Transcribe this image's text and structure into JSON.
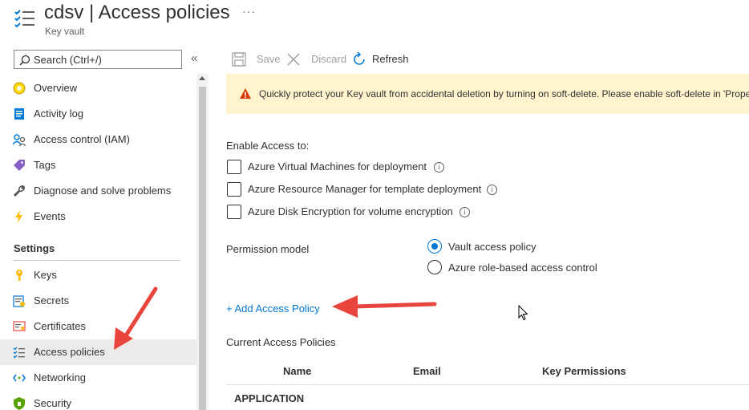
{
  "header": {
    "title": "cdsv | Access policies",
    "subtitle": "Key vault",
    "more": "···"
  },
  "sidebar": {
    "search_placeholder": "Search (Ctrl+/)",
    "collapse": "«",
    "items": [
      {
        "label": "Overview",
        "icon": "overview-icon"
      },
      {
        "label": "Activity log",
        "icon": "activity-log-icon"
      },
      {
        "label": "Access control (IAM)",
        "icon": "iam-icon"
      },
      {
        "label": "Tags",
        "icon": "tag-icon"
      },
      {
        "label": "Diagnose and solve problems",
        "icon": "wrench-icon"
      },
      {
        "label": "Events",
        "icon": "lightning-icon"
      }
    ],
    "settings_header": "Settings",
    "settings_items": [
      {
        "label": "Keys",
        "icon": "key-icon"
      },
      {
        "label": "Secrets",
        "icon": "secrets-icon"
      },
      {
        "label": "Certificates",
        "icon": "certificate-icon"
      },
      {
        "label": "Access policies",
        "icon": "access-policies-icon",
        "active": true
      },
      {
        "label": "Networking",
        "icon": "networking-icon"
      },
      {
        "label": "Security",
        "icon": "shield-icon"
      }
    ]
  },
  "toolbar": {
    "save": "Save",
    "discard": "Discard",
    "refresh": "Refresh"
  },
  "banner": {
    "text": "Quickly protect your Key vault from accidental deletion by turning on soft-delete. Please enable soft-delete in 'Prope"
  },
  "access": {
    "heading": "Enable Access to:",
    "options": [
      {
        "label": "Azure Virtual Machines for deployment",
        "checked": false
      },
      {
        "label": "Azure Resource Manager for template deployment",
        "checked": false
      },
      {
        "label": "Azure Disk Encryption for volume encryption",
        "checked": false
      }
    ],
    "info_glyph": "i"
  },
  "permission": {
    "label": "Permission model",
    "options": [
      {
        "label": "Vault access policy",
        "selected": true
      },
      {
        "label": "Azure role-based access control",
        "selected": false
      }
    ]
  },
  "add_policy": "+ Add Access Policy",
  "current_policies": {
    "heading": "Current Access Policies",
    "columns": [
      "Name",
      "Email",
      "Key Permissions"
    ],
    "group": "APPLICATION"
  },
  "colors": {
    "accent": "#0078d4",
    "warning_bg": "#fff4ce",
    "warning_icon": "#d83b01",
    "annotation_arrow": "#e8453c",
    "active_nav": "#edebe9"
  }
}
